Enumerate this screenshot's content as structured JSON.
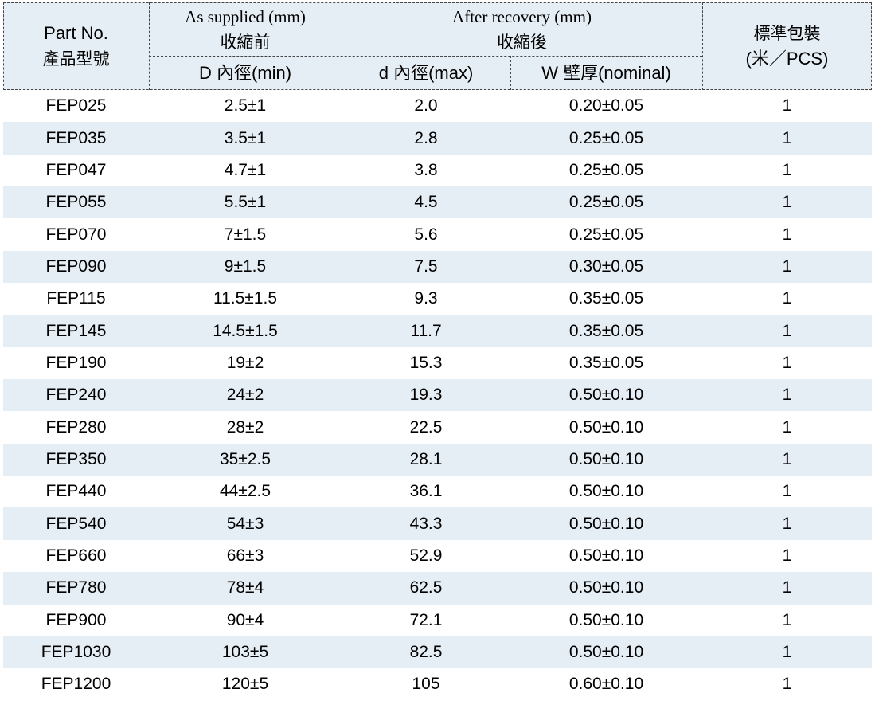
{
  "header": {
    "part_no": {
      "en": "Part No.",
      "zh": "產品型號"
    },
    "as_supplied": {
      "en": "As supplied (mm)",
      "zh": "收縮前"
    },
    "after_recovery": {
      "en": "After recovery (mm)",
      "zh": "收縮後"
    },
    "packing": {
      "zh": "標準包裝",
      "unit": "(米／PCS)"
    },
    "col_D": "D 內徑(min)",
    "col_d": "d 內徑(max)",
    "col_W": "W 壁厚(nominal)"
  },
  "rows": [
    {
      "part": "FEP025",
      "D": "2.5±1",
      "d": "2.0",
      "W": "0.20±0.05",
      "pack": "1"
    },
    {
      "part": "FEP035",
      "D": "3.5±1",
      "d": "2.8",
      "W": "0.25±0.05",
      "pack": "1"
    },
    {
      "part": "FEP047",
      "D": "4.7±1",
      "d": "3.8",
      "W": "0.25±0.05",
      "pack": "1"
    },
    {
      "part": "FEP055",
      "D": "5.5±1",
      "d": "4.5",
      "W": "0.25±0.05",
      "pack": "1"
    },
    {
      "part": "FEP070",
      "D": "7±1.5",
      "d": "5.6",
      "W": "0.25±0.05",
      "pack": "1"
    },
    {
      "part": "FEP090",
      "D": "9±1.5",
      "d": "7.5",
      "W": "0.30±0.05",
      "pack": "1"
    },
    {
      "part": "FEP115",
      "D": "11.5±1.5",
      "d": "9.3",
      "W": "0.35±0.05",
      "pack": "1"
    },
    {
      "part": "FEP145",
      "D": "14.5±1.5",
      "d": "11.7",
      "W": "0.35±0.05",
      "pack": "1"
    },
    {
      "part": "FEP190",
      "D": "19±2",
      "d": "15.3",
      "W": "0.35±0.05",
      "pack": "1"
    },
    {
      "part": "FEP240",
      "D": "24±2",
      "d": "19.3",
      "W": "0.50±0.10",
      "pack": "1"
    },
    {
      "part": "FEP280",
      "D": "28±2",
      "d": "22.5",
      "W": "0.50±0.10",
      "pack": "1"
    },
    {
      "part": "FEP350",
      "D": "35±2.5",
      "d": "28.1",
      "W": "0.50±0.10",
      "pack": "1"
    },
    {
      "part": "FEP440",
      "D": "44±2.5",
      "d": "36.1",
      "W": "0.50±0.10",
      "pack": "1"
    },
    {
      "part": "FEP540",
      "D": "54±3",
      "d": "43.3",
      "W": "0.50±0.10",
      "pack": "1"
    },
    {
      "part": "FEP660",
      "D": "66±3",
      "d": "52.9",
      "W": "0.50±0.10",
      "pack": "1"
    },
    {
      "part": "FEP780",
      "D": "78±4",
      "d": "62.5",
      "W": "0.50±0.10",
      "pack": "1"
    },
    {
      "part": "FEP900",
      "D": "90±4",
      "d": "72.1",
      "W": "0.50±0.10",
      "pack": "1"
    },
    {
      "part": "FEP1030",
      "D": "103±5",
      "d": "82.5",
      "W": "0.50±0.10",
      "pack": "1"
    },
    {
      "part": "FEP1200",
      "D": "120±5",
      "d": "105",
      "W": "0.60±0.10",
      "pack": "1"
    }
  ],
  "colors": {
    "header_bg": "#e6eef5",
    "alt_row_bg": "#e6eef5",
    "border": "#444444"
  }
}
